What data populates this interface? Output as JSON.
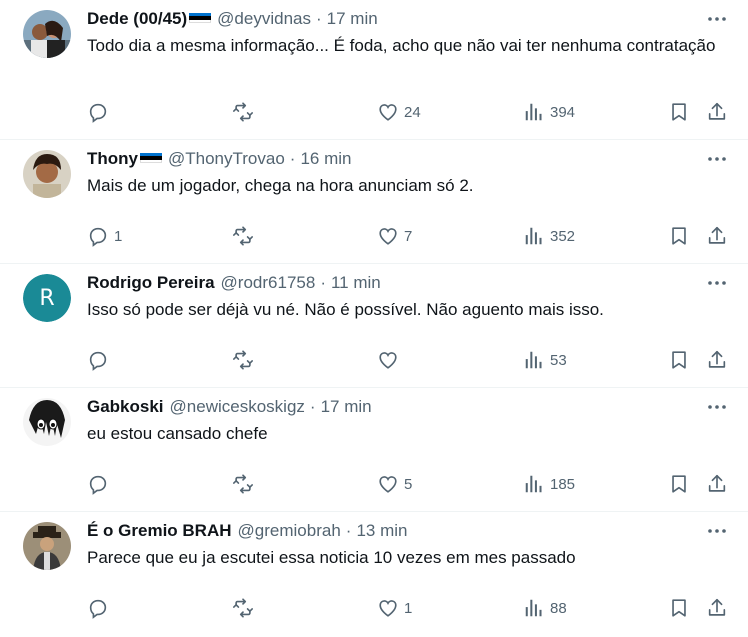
{
  "tweets": [
    {
      "name": "Dede (00/45)",
      "flag": true,
      "handle": "@deyvidnas",
      "time": "17 min",
      "text": "Todo dia a mesma informação... É foda, acho que não vai ter nenhuma contratação",
      "replies": "",
      "retweets": "",
      "likes": "24",
      "views": "394"
    },
    {
      "name": "Thony",
      "flag": true,
      "handle": "@ThonyTrovao",
      "time": "16 min",
      "text": "Mais de um jogador, chega na hora anunciam só 2.",
      "replies": "1",
      "retweets": "",
      "likes": "7",
      "views": "352"
    },
    {
      "name": "Rodrigo Pereira",
      "flag": false,
      "handle": "@rodr61758",
      "time": "11 min",
      "text": "Isso só pode ser déjà vu né. Não é possível. Não aguento mais isso.",
      "avatar_letter": "R",
      "replies": "",
      "retweets": "",
      "likes": "",
      "views": "53"
    },
    {
      "name": "Gabkoski",
      "flag": false,
      "handle": "@newiceskoskigz",
      "time": "17 min",
      "text": "eu estou cansado chefe",
      "replies": "",
      "retweets": "",
      "likes": "5",
      "views": "185"
    },
    {
      "name": "É o Gremio BRAH",
      "flag": false,
      "handle": "@gremiobrah",
      "time": "13 min",
      "text": "Parece que eu ja escutei essa noticia 10 vezes em mes passado",
      "replies": "",
      "retweets": "",
      "likes": "1",
      "views": "88"
    }
  ],
  "separator": "·",
  "colors": {
    "text": "#0f1419",
    "secondary": "#536471",
    "divider": "#eff3f4",
    "avatar_letter_bg": "#1a8a96",
    "flag": [
      "#0072ce",
      "#000000",
      "#ffffff"
    ]
  },
  "icons": [
    "more-icon",
    "reply-icon",
    "retweet-icon",
    "like-icon",
    "views-icon",
    "bookmark-icon",
    "share-icon"
  ]
}
